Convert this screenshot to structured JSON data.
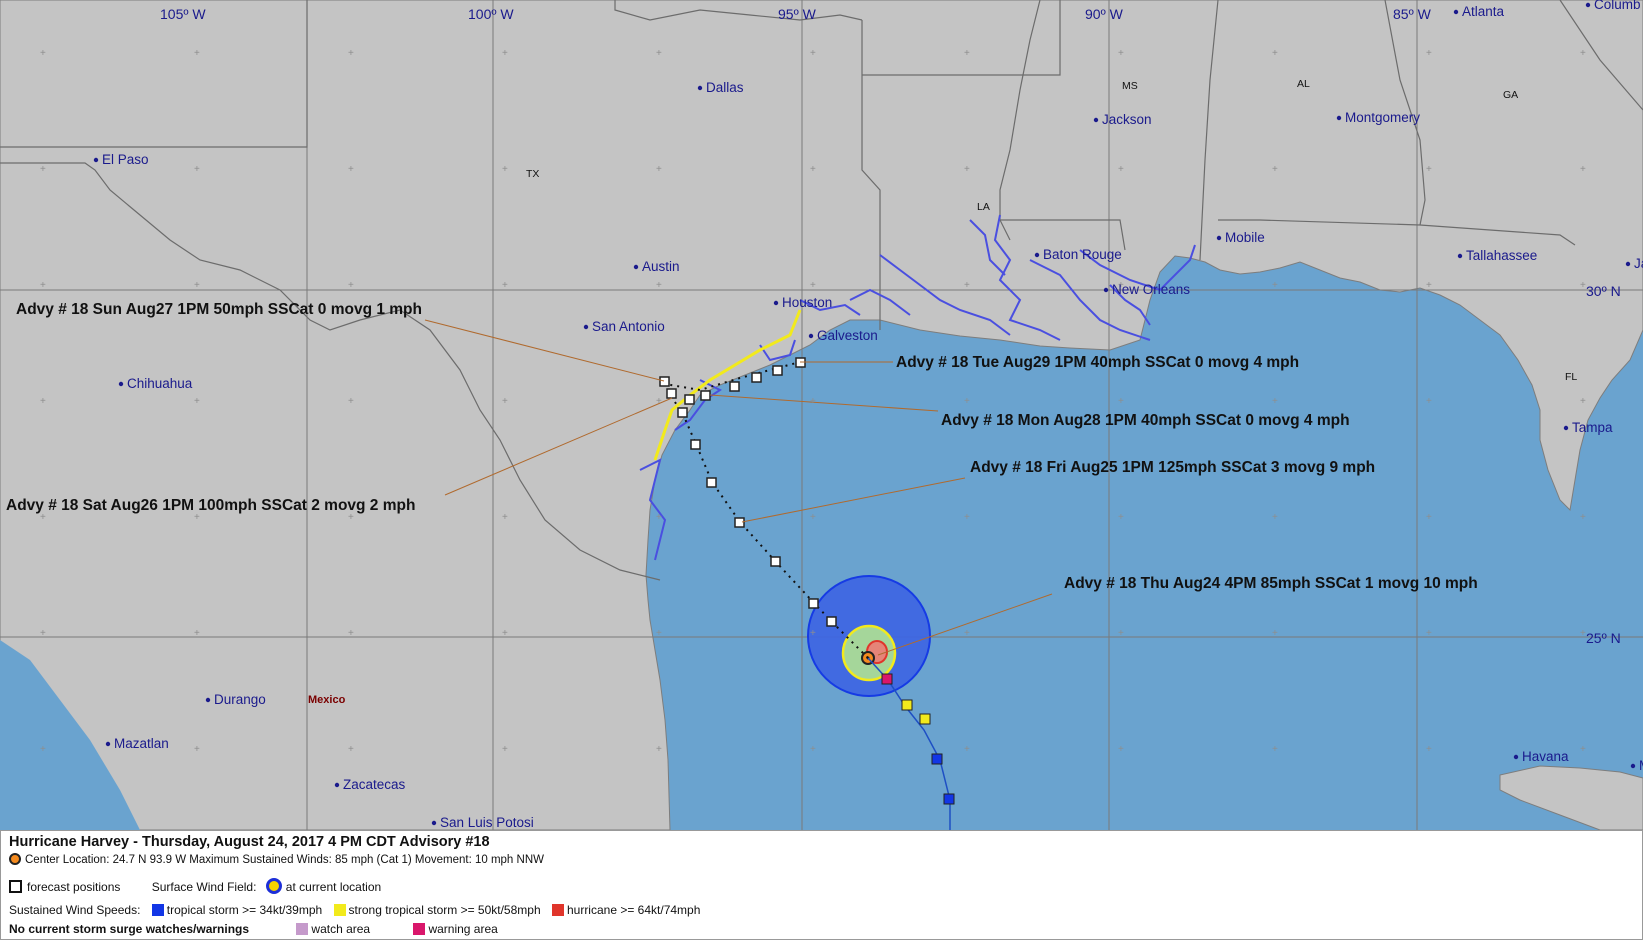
{
  "longitude_labels": [
    "105º W",
    "100º W",
    "95º W",
    "90º W",
    "85º W"
  ],
  "latitude_labels": [
    "30º N",
    "25º N"
  ],
  "cities": [
    {
      "name": "El Paso"
    },
    {
      "name": "Dallas"
    },
    {
      "name": "Austin"
    },
    {
      "name": "San Antonio"
    },
    {
      "name": "Houston"
    },
    {
      "name": "Galveston"
    },
    {
      "name": "Chihuahua"
    },
    {
      "name": "Durango"
    },
    {
      "name": "Mazatlan"
    },
    {
      "name": "Zacatecas"
    },
    {
      "name": "San Luis Potosi"
    },
    {
      "name": "Jackson"
    },
    {
      "name": "Baton Rouge"
    },
    {
      "name": "New Orleans"
    },
    {
      "name": "Mobile"
    },
    {
      "name": "Montgomery"
    },
    {
      "name": "Atlanta"
    },
    {
      "name": "Columb"
    },
    {
      "name": "Tallahassee"
    },
    {
      "name": "Tampa"
    },
    {
      "name": "Havana"
    },
    {
      "name": "Ja"
    },
    {
      "name": "M"
    }
  ],
  "states": [
    "TX",
    "LA",
    "MS",
    "AL",
    "GA",
    "FL"
  ],
  "country_label": "Mexico",
  "advisories": [
    "Advy # 18 Sun Aug27 1PM  50mph SSCat 0 movg 1 mph",
    "Advy # 18 Tue Aug29 1PM  40mph SSCat 0 movg 4 mph",
    "Advy # 18 Mon Aug28 1PM  40mph SSCat 0 movg 4 mph",
    "Advy # 18 Fri Aug25 1PM  125mph SSCat 3 movg 9 mph",
    "Advy # 18 Sat Aug26 1PM  100mph SSCat 2 movg 2 mph",
    "Advy # 18 Thu Aug24 4PM  85mph SSCat 1 movg 10 mph"
  ],
  "storm": {
    "center_lat": 24.7,
    "center_lon": -93.9,
    "max_wind_mph": 85,
    "category": 1
  },
  "legend": {
    "title": "Hurricane Harvey  -  Thursday, August 24, 2017  4 PM CDT   Advisory #18",
    "center_location": "Center Location: 24.7 N  93.9 W   Maximum Sustained Winds: 85 mph (Cat 1) Movement: 10 mph NNW",
    "forecast_positions": "forecast positions",
    "surface_wind_field": "Surface Wind Field:",
    "at_current_location": "at current location",
    "sustained_wind_speeds": "Sustained Wind Speeds:",
    "tropical_storm": "tropical storm >= 34kt/39mph",
    "strong_tropical_storm": "strong tropical storm >= 50kt/58mph",
    "hurricane": "hurricane >= 64kt/74mph",
    "surge_note": "No current storm surge watches/warnings",
    "watch_area": "watch area",
    "warning_area": "warning area"
  },
  "colors": {
    "land": "#c4c4c4",
    "water": "#6aa3cf",
    "tropical_storm": "#1236e6",
    "strong_tropical_storm": "#f2ea1c",
    "hurricane": "#e0352b",
    "watch": "#c59acb",
    "warning": "#d9176b",
    "rivers": "#4a4fe0"
  }
}
